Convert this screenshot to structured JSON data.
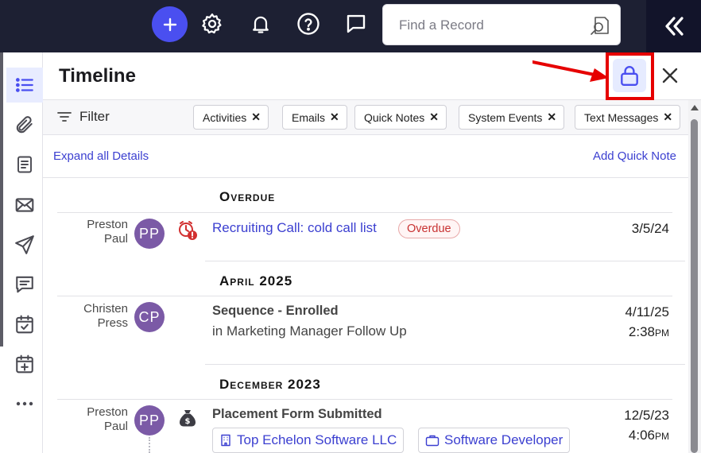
{
  "topbar": {
    "icons": [
      "plus-icon",
      "gear-icon",
      "bell-icon",
      "help-icon",
      "chat-icon",
      "double-chevron-left-icon"
    ],
    "search_placeholder": "Find a Record",
    "colors": {
      "bar": "#1d2033",
      "accent": "#4a4ff0"
    }
  },
  "rail": {
    "icons": [
      "timeline-list-icon",
      "paperclip-icon",
      "document-icon",
      "mail-icon",
      "send-icon",
      "message-icon",
      "calendar-check-icon",
      "calendar-plus-icon",
      "more-icon"
    ],
    "active": "timeline-list-icon"
  },
  "panel": {
    "title": "Timeline",
    "filter_label": "Filter",
    "filters": [
      "Activities",
      "Emails",
      "Quick Notes",
      "System Events",
      "Text Messages"
    ],
    "expand_label": "Expand all Details",
    "add_note_label": "Add Quick Note",
    "highlight_color": "#e60000"
  },
  "timeline": {
    "sections": [
      {
        "heading": "Overdue",
        "events": [
          {
            "person_first": "Preston",
            "person_last": "Paul",
            "initials": "PP",
            "icon": "overdue-alarm-icon",
            "title": "Recruiting Call: cold call list",
            "badge": "Overdue",
            "date": "3/5/24"
          }
        ]
      },
      {
        "heading": "April 2025",
        "events": [
          {
            "person_first": "Christen",
            "person_last": "Press",
            "initials": "CP",
            "title": "Sequence - Enrolled",
            "subtitle": "in Marketing Manager Follow Up",
            "date": "4/11/25",
            "time": "2:38",
            "ampm": "PM"
          }
        ]
      },
      {
        "heading": "December 2023",
        "events": [
          {
            "person_first": "Preston",
            "person_last": "Paul",
            "initials": "PP",
            "icon": "money-bag-icon",
            "title": "Placement Form Submitted",
            "records": [
              "Top Echelon Software LLC",
              "Software Developer"
            ],
            "date": "12/5/23",
            "time": "4:06",
            "ampm": "PM"
          }
        ]
      }
    ]
  }
}
